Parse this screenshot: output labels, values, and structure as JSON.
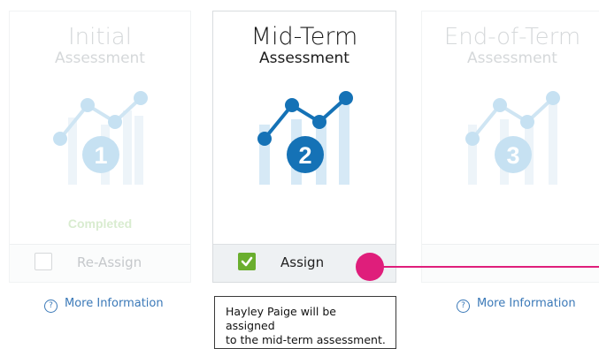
{
  "cards": [
    {
      "title": "Initial",
      "subtitle": "Assessment",
      "number": "1",
      "status": "Completed",
      "action_label": "Re-Assign",
      "checked": false,
      "state": "faded"
    },
    {
      "title": "Mid-Term",
      "subtitle": "Assessment",
      "number": "2",
      "status": "",
      "action_label": "Assign",
      "checked": true,
      "state": "active"
    },
    {
      "title": "End-of-Term",
      "subtitle": "Assessment",
      "number": "3",
      "status": "",
      "action_label": "",
      "checked": false,
      "state": "faded"
    }
  ],
  "more_info_links": [
    {
      "label": "More Information",
      "icon": "question-circle-icon"
    },
    {
      "label": "More Information",
      "icon": "question-circle-icon"
    }
  ],
  "tooltip": {
    "line1": "Hayley Paige will be assigned",
    "line2": "to the mid-term assessment."
  },
  "colors": {
    "active_blue": "#1572b6",
    "faded_blue": "#c6e1f2",
    "check_green": "#6aae2e",
    "pointer_pink": "#df1e7b",
    "link_blue": "#3b79b8"
  }
}
